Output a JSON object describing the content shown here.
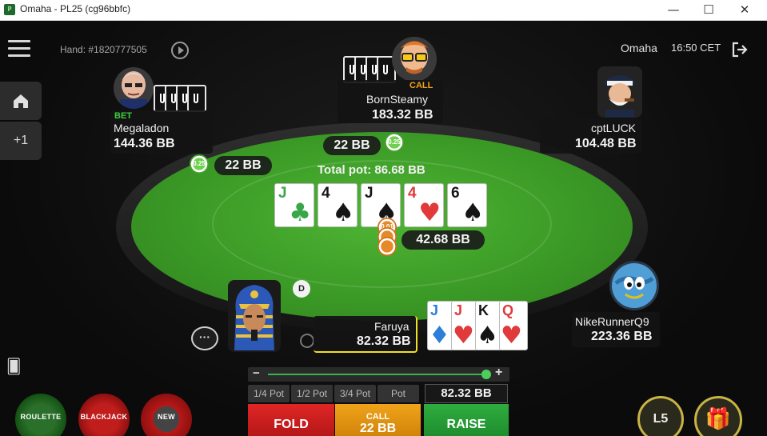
{
  "window": {
    "title": "Omaha - PL25 (cg96bbfc)",
    "minimize": "—",
    "maximize": "☐",
    "close": "✕"
  },
  "header": {
    "hand_id": "Hand: #1820777505",
    "game": "Omaha",
    "time": "16:50 CET"
  },
  "sidebar": {
    "plus_label": "+1"
  },
  "players": {
    "megaladon": {
      "name": "Megaladon",
      "stack": "144.36 BB",
      "action": "BET",
      "bet": "22 BB",
      "chip": "0.25"
    },
    "bornsteamy": {
      "name": "BornSteamy",
      "stack": "183.32 BB",
      "action": "CALL",
      "bet": "22 BB",
      "chip": "0.25"
    },
    "cptluck": {
      "name": "cptLUCK",
      "stack": "104.48 BB"
    },
    "nikerunner": {
      "name": "NikeRunnerQ9",
      "stack": "223.36 BB"
    },
    "hero": {
      "name": "Faruya",
      "stack": "82.32 BB"
    }
  },
  "pot": {
    "total_label": "Total pot: 86.68 BB",
    "main": "42.68 BB",
    "chip": "0.01"
  },
  "dealer": "D",
  "board": [
    {
      "rank": "J",
      "suit": "♣",
      "color": "green"
    },
    {
      "rank": "4",
      "suit": "♠",
      "color": "black"
    },
    {
      "rank": "J",
      "suit": "♠",
      "color": "black"
    },
    {
      "rank": "4",
      "suit": "♥",
      "color": "red"
    },
    {
      "rank": "6",
      "suit": "♠",
      "color": "black"
    }
  ],
  "hero_cards": [
    {
      "rank": "J",
      "suit": "♦",
      "color": "blue"
    },
    {
      "rank": "J",
      "suit": "♥",
      "color": "red"
    },
    {
      "rank": "K",
      "suit": "♠",
      "color": "black"
    },
    {
      "rank": "Q",
      "suit": "♥",
      "color": "red"
    }
  ],
  "actions": {
    "presets": [
      "1/4 Pot",
      "1/2 Pot",
      "3/4 Pot",
      "Pot"
    ],
    "raise_amount": "82.32 BB",
    "fold": "FOLD",
    "call_label": "CALL",
    "call_amount": "22 BB",
    "raise": "RAISE",
    "slider_fraction": 1.0
  },
  "bottom": {
    "promo_roulette": "ROULETTE",
    "promo_blackjack": "BLACKJACK",
    "promo_new": "NEW",
    "level": "L5",
    "gift": "🎁"
  },
  "colors": {
    "felt": "#3b9a26",
    "bet": "#3fcf3f",
    "call": "#f0a31a",
    "fold": "#d81f1f",
    "raise": "#27a337"
  }
}
